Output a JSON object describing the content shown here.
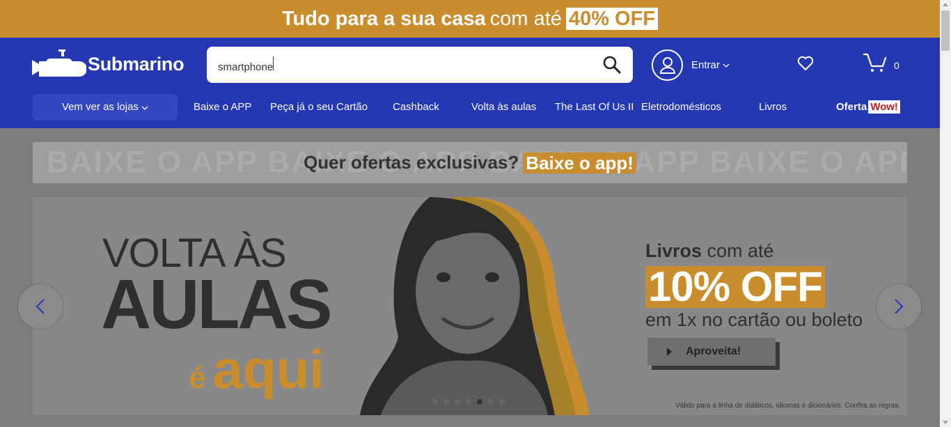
{
  "promo": {
    "part1": "Tudo para a sua casa",
    "part2": "com até",
    "part3": "40% OFF"
  },
  "header": {
    "logo_text": "Submarino",
    "search": {
      "value": "smartphone"
    },
    "account_label": "Entrar",
    "cart_count": "0"
  },
  "nav": {
    "stores": "Vem ver as lojas",
    "items": [
      "Baixe o APP",
      "Peça já o seu Cartão",
      "Cashback",
      "Volta às aulas",
      "The Last Of Us II",
      "Eletrodomésticos",
      "Livros"
    ],
    "oferta": "Oferta",
    "wow": "Wow!"
  },
  "app_banner": {
    "ghost": "BAIXE O APP  BAIXE O APP  BAIXE O APP  BAIXE O APP  BAIXE O APP",
    "question": "Quer ofertas exclusivas?",
    "cta": "Baixe o app!"
  },
  "hero": {
    "line1": "VOLTA ÀS",
    "line2": "AULAS",
    "line3a": "é",
    "line3b": "aqui",
    "livros_bold": "Livros",
    "livros_rest": " com até",
    "discount": "10% OFF",
    "payment": "em 1x no cartão ou boleto",
    "cta": "Aproveita!",
    "disclaimer": "Válido para a linha de didáticos, idiomas e dicionários. Confira as regras.",
    "slides": 7,
    "active_slide": 5
  },
  "colors": {
    "brand_blue": "#2538b3",
    "accent_orange": "#c98d2d",
    "wow_red": "#c51b26"
  }
}
